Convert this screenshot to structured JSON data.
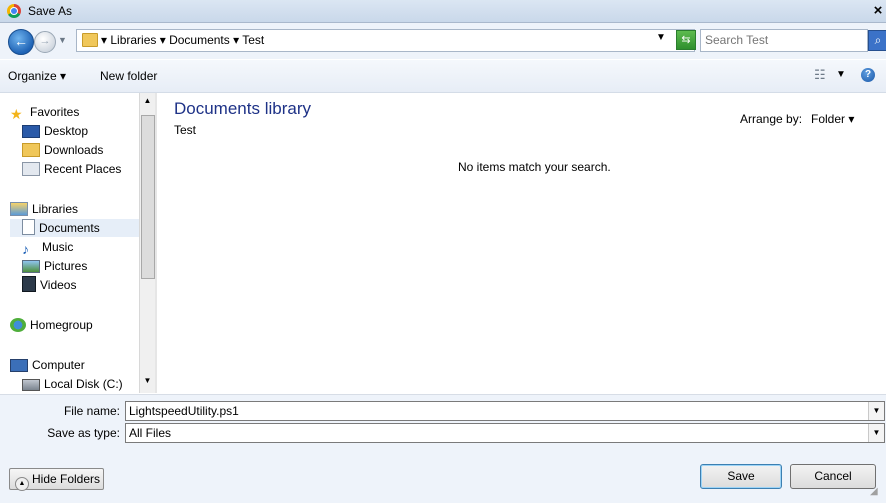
{
  "window": {
    "title": "Save As",
    "close_glyph": "×"
  },
  "address_bar": {
    "breadcrumb": "▾ Libraries ▾ Documents ▾ Test",
    "search_placeholder": "Search Test"
  },
  "toolbar": {
    "organize_label": "Organize ▾",
    "new_folder_label": "New folder"
  },
  "nav": {
    "items": [
      {
        "label": "Favorites",
        "icon": "star-icon"
      },
      {
        "label": "Desktop",
        "icon": "desktop-icon"
      },
      {
        "label": "Downloads",
        "icon": "downloads-icon"
      },
      {
        "label": "Recent Places",
        "icon": "recent-places-icon"
      },
      {
        "label": "Libraries",
        "icon": "libraries-icon"
      },
      {
        "label": "Documents",
        "icon": "documents-icon"
      },
      {
        "label": "Music",
        "icon": "music-icon"
      },
      {
        "label": "Pictures",
        "icon": "pictures-icon"
      },
      {
        "label": "Videos",
        "icon": "videos-icon"
      },
      {
        "label": "Homegroup",
        "icon": "homegroup-icon"
      },
      {
        "label": "Computer",
        "icon": "computer-icon"
      },
      {
        "label": "Local Disk (C:)",
        "icon": "local-disk-icon"
      }
    ]
  },
  "content": {
    "library_title": "Documents library",
    "library_subtitle": "Test",
    "arrange_label": "Arrange by:",
    "arrange_value": "Folder ▾",
    "empty_message": "No items match your search."
  },
  "fields": {
    "file_name_label": "File name:",
    "file_name_value": "LightspeedUtility.ps1",
    "save_type_label": "Save as type:",
    "save_type_value": "All Files"
  },
  "buttons": {
    "hide_folders": "Hide Folders",
    "save": "Save",
    "cancel": "Cancel"
  },
  "colors": {
    "library_title": "#1e3287",
    "selection": "#e6eef8"
  }
}
